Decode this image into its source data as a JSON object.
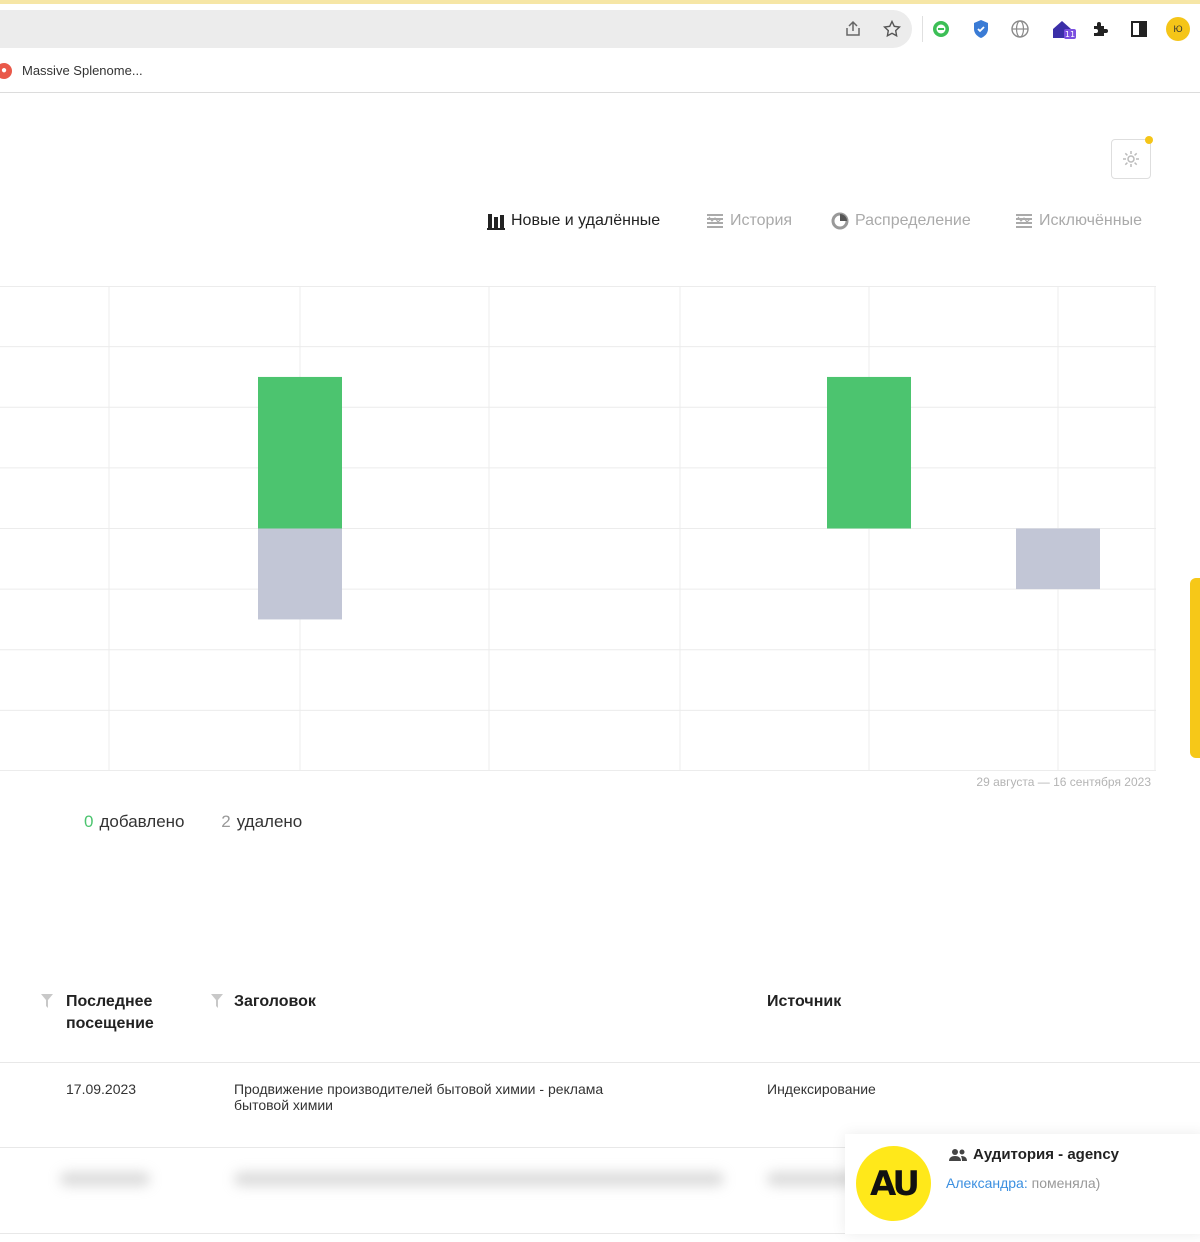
{
  "browser": {
    "bookmark_label": "Massive Splenome...",
    "bookmark_icon": "splenome-favicon",
    "toolbar_icons": [
      "share-icon",
      "star-icon",
      "chat-extension-icon",
      "shield-extension-icon",
      "globe-extension-icon",
      "home-extension-icon",
      "puzzle-icon",
      "side-panel-icon",
      "profile-avatar"
    ],
    "profile_initials": "Ю"
  },
  "tabs": [
    {
      "label": "Новые и удалённые",
      "icon": "bar-chart-icon",
      "active": true
    },
    {
      "label": "История",
      "icon": "list-icon",
      "active": false
    },
    {
      "label": "Распределение",
      "icon": "pie-chart-icon",
      "active": false
    },
    {
      "label": "Исключённые",
      "icon": "list-icon",
      "active": false
    }
  ],
  "chart_data": {
    "type": "bar",
    "series": [
      {
        "color": "#4cc46f",
        "bars": [
          {
            "x_index": 1,
            "from": 0,
            "to": 2.5
          },
          {
            "x_index": 4,
            "from": 0,
            "to": 2.5
          }
        ]
      },
      {
        "color": "#c2c6d6",
        "bars": [
          {
            "x_index": 1,
            "from": -1.5,
            "to": 0
          },
          {
            "x_index": 5,
            "from": -1,
            "to": 0
          }
        ]
      }
    ],
    "ylim": [
      -4,
      4
    ],
    "grid": true,
    "date_range": "29 августа — 16 сентября 2023"
  },
  "counts": {
    "added_value": "0",
    "added_label": "добавлено",
    "removed_value": "2",
    "removed_label": "удалено"
  },
  "table": {
    "headers": [
      "Последнее посещение",
      "Заголовок",
      "Источник"
    ],
    "header_last_visit_line1": "Последнее",
    "header_last_visit_line2": "посещение",
    "rows": [
      {
        "date": "17.09.2023",
        "title_line1": "Продвижение производителей бытовой химии - реклама",
        "title_line2": "бытовой химии",
        "source": "Индексирование"
      }
    ]
  },
  "notification": {
    "avatar_text": "AU",
    "title": "Аудитория - agency",
    "author": "Александра:",
    "message": "поменяла)"
  }
}
